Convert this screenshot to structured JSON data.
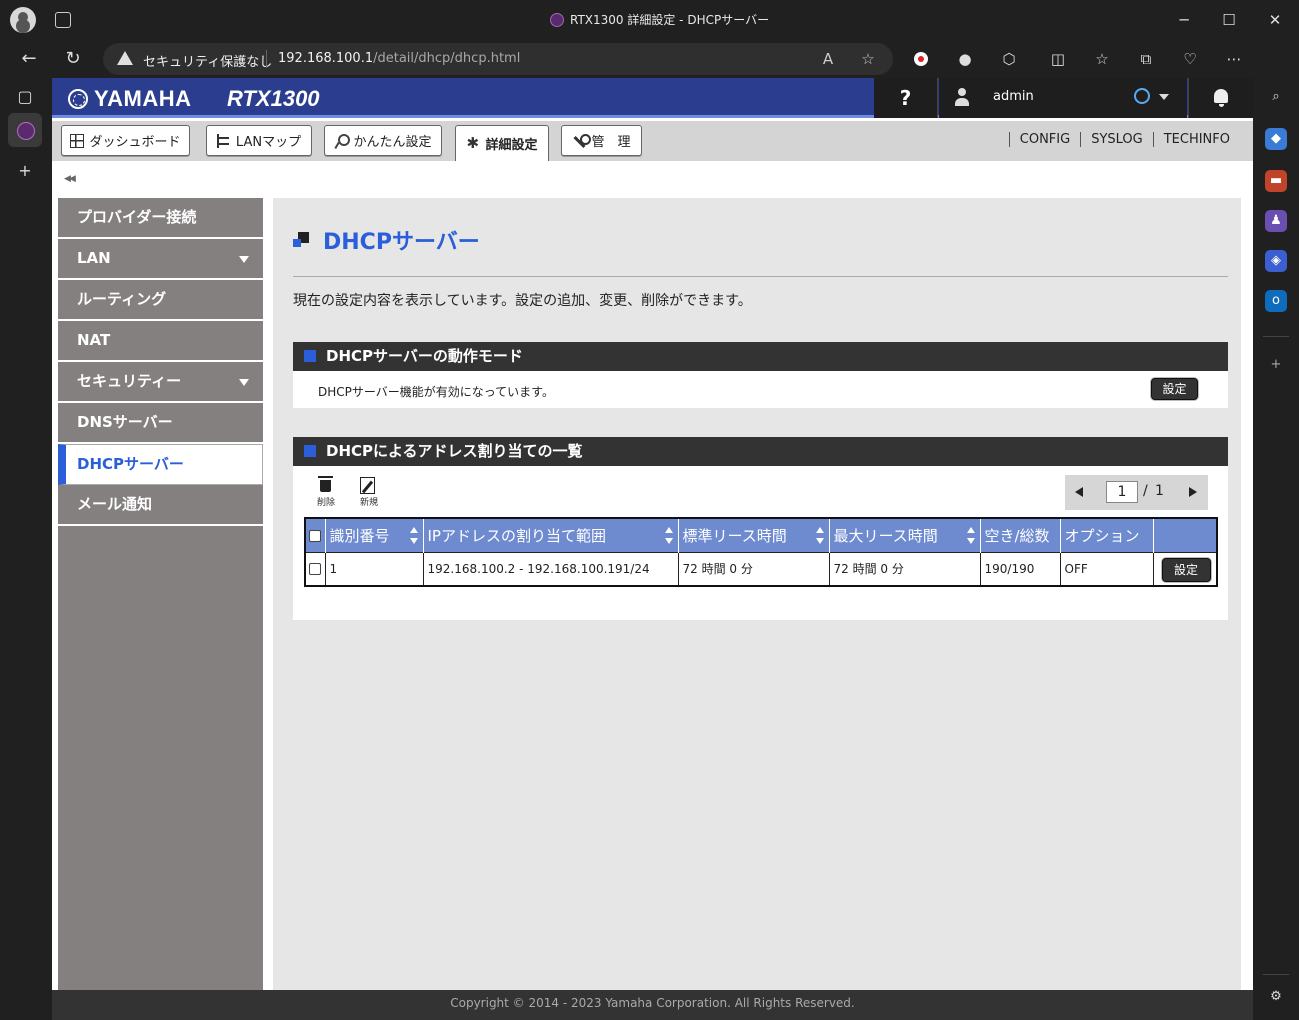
{
  "browser": {
    "window_title": "RTX1300 詳細設定 - DHCPサーバー",
    "security_label": "セキュリティ保護なし",
    "url_host": "192.168.100.1",
    "url_path": "/detail/dhcp/dhcp.html"
  },
  "header": {
    "brand": "YAMAHA",
    "model": "RTX1300",
    "help": "?",
    "user": "admin"
  },
  "tabs": [
    {
      "label": "ダッシュボード",
      "icon": "dashboard-icon"
    },
    {
      "label": "LANマップ",
      "icon": "lan-map-icon"
    },
    {
      "label": "かんたん設定",
      "icon": "key-icon"
    },
    {
      "label": "詳細設定",
      "icon": "gear-icon",
      "active": true
    },
    {
      "label": "管　理",
      "icon": "wrench-icon"
    }
  ],
  "top_links": [
    "CONFIG",
    "SYSLOG",
    "TECHINFO"
  ],
  "sidebar": {
    "collapse": "◀◀",
    "items": [
      {
        "label": "プロバイダー接続"
      },
      {
        "label": "LAN",
        "has_submenu": true
      },
      {
        "label": "ルーティング"
      },
      {
        "label": "NAT"
      },
      {
        "label": "セキュリティー",
        "has_submenu": true
      },
      {
        "label": "DNSサーバー"
      },
      {
        "label": "DHCPサーバー",
        "active": true
      },
      {
        "label": "メール通知"
      }
    ]
  },
  "main": {
    "title": "DHCPサーバー",
    "description": "現在の設定内容を表示しています。設定の追加、変更、削除ができます。",
    "mode_section": {
      "heading": "DHCPサーバーの動作モード",
      "status": "DHCPサーバー機能が有効になっています。",
      "button": "設定"
    },
    "list_section": {
      "heading": "DHCPによるアドレス割り当ての一覧",
      "delete_label": "削除",
      "new_label": "新規",
      "page_current": "1",
      "page_sep": "/",
      "page_total": "1",
      "columns": [
        "識別番号",
        "IPアドレスの割り当て範囲",
        "標準リース時間",
        "最大リース時間",
        "空き/総数",
        "オプション"
      ],
      "rows": [
        {
          "id": "1",
          "range": "192.168.100.2 - 192.168.100.191/24",
          "lease": "72 時間 0 分",
          "max_lease": "72 時間 0 分",
          "free_total": "190/190",
          "option": "OFF",
          "button": "設定"
        }
      ]
    }
  },
  "footer": "Copyright © 2014 - 2023 Yamaha Corporation. All Rights Reserved.",
  "colors": {
    "accent": "#2b5fd9",
    "header": "#2a3d8f",
    "table_head": "#6e8bd0",
    "sidebar": "#858080"
  }
}
